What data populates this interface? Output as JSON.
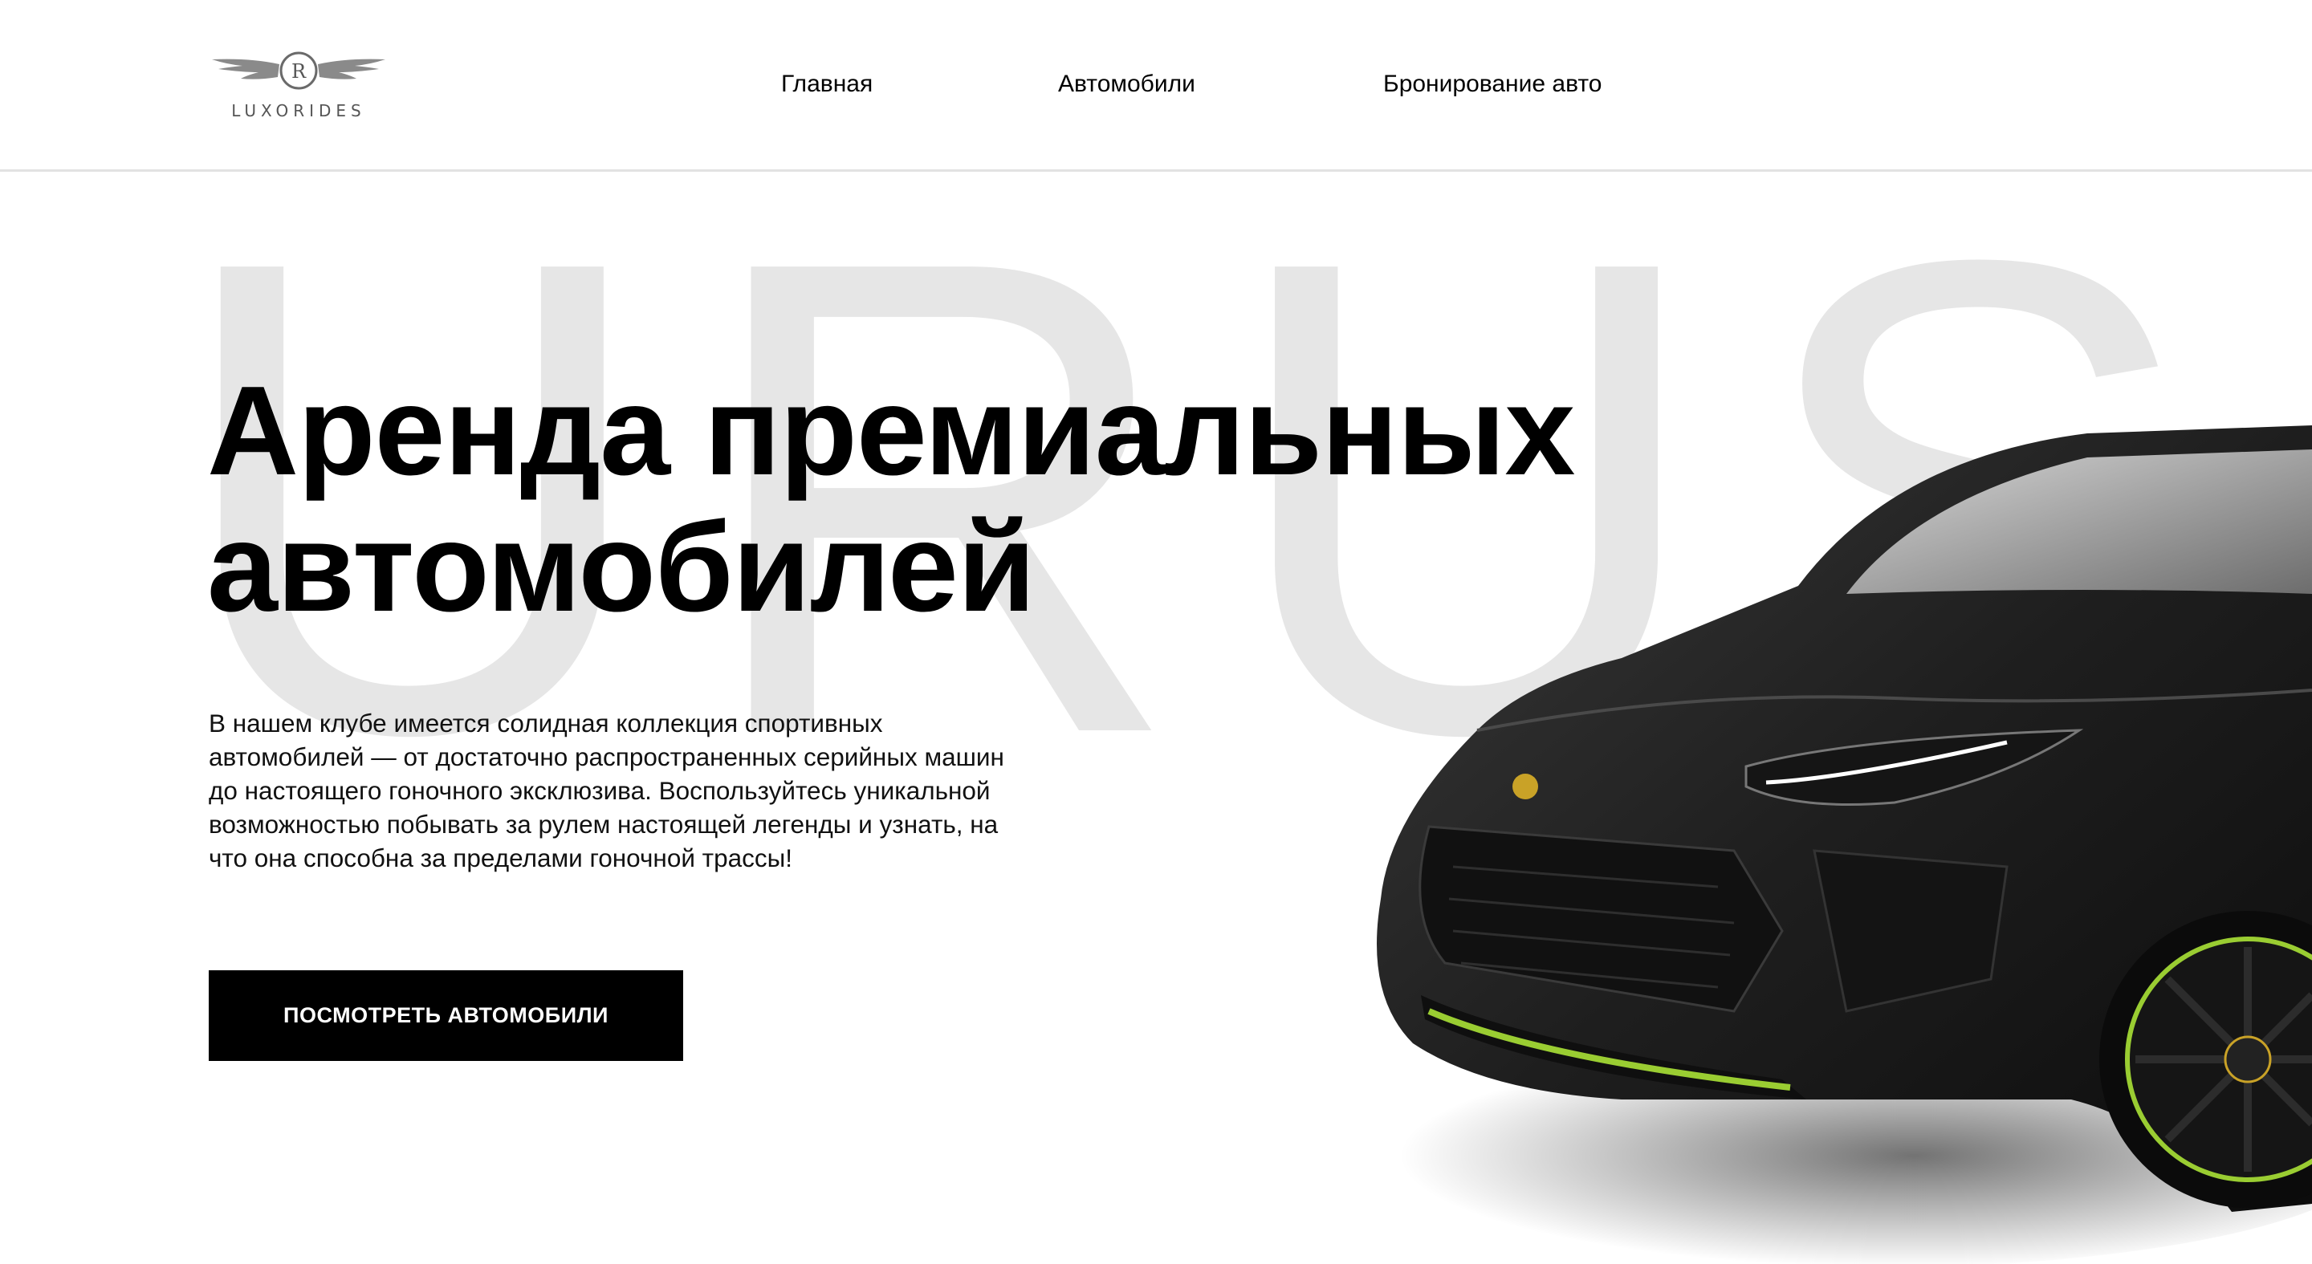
{
  "brand": {
    "name": "LUXORIDES",
    "monogram": "R"
  },
  "nav": [
    {
      "label": "Главная"
    },
    {
      "label": "Автомобили"
    },
    {
      "label": "Бронирование авто"
    }
  ],
  "hero": {
    "watermark": "URUS",
    "title_line1": "Аренда премиальных",
    "title_line2": "автомобилей",
    "description": "В нашем клубе имеется солидная коллекция спортивных автомобилей — от достаточно распространенных серийных машин до настоящего гоночного эксклюзива. Воспользуйтесь уникальной возможностью побывать за рулем настоящей легенды и узнать, на что она способна за пределами гоночной трассы!",
    "cta_label": "ПОСМОТРЕТЬ АВТОМОБИЛИ"
  },
  "icons": [
    "winged-logo-icon",
    "car-image"
  ],
  "colors": {
    "background": "#ffffff",
    "text": "#000000",
    "button_bg": "#000000",
    "button_text": "#ffffff",
    "watermark": "#e6e6e6",
    "car_accent": "#9acd32"
  }
}
